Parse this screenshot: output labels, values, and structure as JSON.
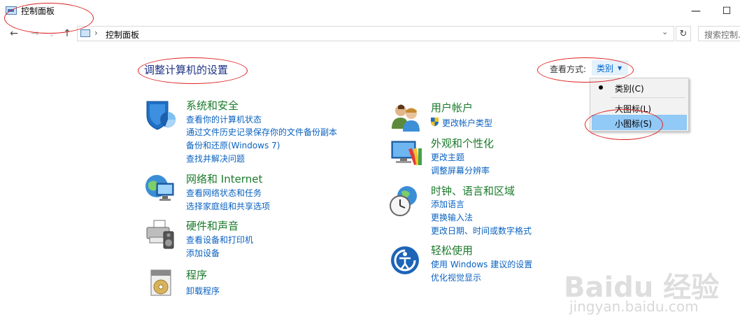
{
  "window": {
    "title": "控制面板",
    "minimize_glyph": "—",
    "maximize_glyph": "☐"
  },
  "nav": {
    "back_glyph": "←",
    "forward_glyph": "→",
    "recent_glyph": "⌄",
    "up_glyph": "↑"
  },
  "address": {
    "separator": "›",
    "path": "控制面板",
    "dropdown_glyph": "⌄",
    "refresh_glyph": "↻",
    "search_placeholder": "搜索控制..."
  },
  "main": {
    "heading": "调整计算机的设置",
    "view_by_label": "查看方式:",
    "view_by_value": "类别",
    "view_by_arrow": "▼"
  },
  "view_menu": {
    "items": [
      {
        "label": "类别(C)",
        "checked": true
      },
      {
        "label": "大图标(L)",
        "checked": false
      },
      {
        "label": "小图标(S)",
        "checked": false,
        "highlighted": true
      }
    ]
  },
  "categories": {
    "left": [
      {
        "icon": "shield-icon",
        "title": "系统和安全",
        "links": [
          "查看你的计算机状态",
          "通过文件历史记录保存你的文件备份副本",
          "备份和还原(Windows 7)",
          "查找并解决问题"
        ]
      },
      {
        "icon": "network-globe-icon",
        "title": "网络和 Internet",
        "links": [
          "查看网络状态和任务",
          "选择家庭组和共享选项"
        ]
      },
      {
        "icon": "printer-speaker-icon",
        "title": "硬件和声音",
        "links": [
          "查看设备和打印机",
          "添加设备"
        ]
      },
      {
        "icon": "programs-disc-icon",
        "title": "程序",
        "links": [
          "卸载程序"
        ]
      }
    ],
    "right": [
      {
        "icon": "users-icon",
        "title": "用户帐户",
        "links": [
          "更改帐户类型"
        ]
      },
      {
        "icon": "monitor-palette-icon",
        "title": "外观和个性化",
        "links": [
          "更改主题",
          "调整屏幕分辨率"
        ]
      },
      {
        "icon": "clock-globe-icon",
        "title": "时钟、语言和区域",
        "links": [
          "添加语言",
          "更换输入法",
          "更改日期、时间或数字格式"
        ]
      },
      {
        "icon": "accessibility-icon",
        "title": "轻松使用",
        "links": [
          "使用 Windows 建议的设置",
          "优化视觉显示"
        ]
      }
    ]
  },
  "watermark": {
    "brand": "Baidu 经验",
    "url": "jingyan.baidu.com"
  },
  "colors": {
    "heading": "#1e3287",
    "category_title": "#1a7a2a",
    "link": "#0a62c0",
    "menu_highlight": "#91c9f7",
    "annotation": "#dd2222"
  }
}
